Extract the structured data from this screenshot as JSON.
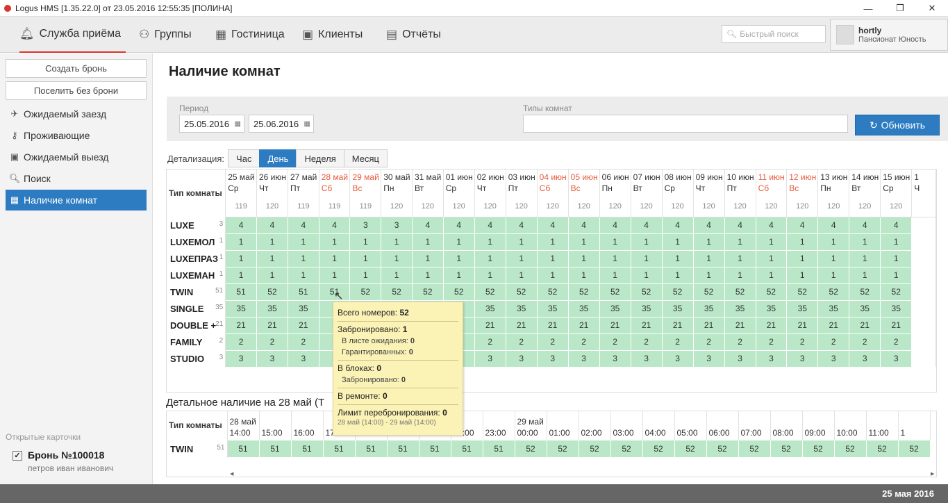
{
  "window": {
    "title": "Logus HMS [1.35.22.0] от 23.05.2016 12:55:35 [ПОЛИНА]"
  },
  "nav": {
    "items": [
      {
        "label": "Служба приёма"
      },
      {
        "label": "Группы"
      },
      {
        "label": "Гостиница"
      },
      {
        "label": "Клиенты"
      },
      {
        "label": "Отчёты"
      }
    ],
    "search_placeholder": "Быстрый поиск",
    "user": {
      "name": "hortly",
      "hotel": "Пансионат Юность"
    }
  },
  "sidebar": {
    "create": "Создать бронь",
    "checkin": "Поселить без брони",
    "menu": [
      {
        "label": "Ожидаемый заезд"
      },
      {
        "label": "Проживающие"
      },
      {
        "label": "Ожидаемый выезд"
      },
      {
        "label": "Поиск"
      },
      {
        "label": "Наличие комнат"
      }
    ],
    "open_cards_label": "Открытые карточки",
    "card": {
      "title": "Бронь №100018",
      "subtitle": "петров иван иванович"
    }
  },
  "page": {
    "title": "Наличие комнат",
    "period_label": "Период",
    "date_from": "25.05.2016",
    "date_to": "25.06.2016",
    "room_types_label": "Типы комнат",
    "refresh": "Обновить",
    "detail_label": "Детализация:",
    "detail_options": [
      "Час",
      "День",
      "Неделя",
      "Месяц"
    ],
    "detail_selected": "День",
    "grid_header": "Тип комнаты",
    "days": [
      [
        "25 май",
        "Ср",
        0
      ],
      [
        "26 июн",
        "Чт",
        0
      ],
      [
        "27 май",
        "Пт",
        0
      ],
      [
        "28 май",
        "Сб",
        1
      ],
      [
        "29 май",
        "Вс",
        1
      ],
      [
        "30 май",
        "Пн",
        0
      ],
      [
        "31 май",
        "Вт",
        0
      ],
      [
        "01 июн",
        "Ср",
        0
      ],
      [
        "02 июн",
        "Чт",
        0
      ],
      [
        "03 июн",
        "Пт",
        0
      ],
      [
        "04 июн",
        "Сб",
        1
      ],
      [
        "05 июн",
        "Вс",
        1
      ],
      [
        "06 июн",
        "Пн",
        0
      ],
      [
        "07 июн",
        "Вт",
        0
      ],
      [
        "08 июн",
        "Ср",
        0
      ],
      [
        "09 июн",
        "Чт",
        0
      ],
      [
        "10 июн",
        "Пт",
        0
      ],
      [
        "11 июн",
        "Сб",
        1
      ],
      [
        "12 июн",
        "Вс",
        1
      ],
      [
        "13 июн",
        "Пн",
        0
      ],
      [
        "14 июн",
        "Вт",
        0
      ],
      [
        "15 июн",
        "Ср",
        0
      ],
      [
        "1",
        "Ч",
        0
      ]
    ],
    "totals": [
      "119",
      "120",
      "119",
      "119",
      "119",
      "120",
      "120",
      "120",
      "120",
      "120",
      "120",
      "120",
      "120",
      "120",
      "120",
      "120",
      "120",
      "120",
      "120",
      "120",
      "120",
      "120",
      ""
    ],
    "rooms": [
      {
        "name": "LUXE",
        "qty": "3",
        "v": [
          "4",
          "4",
          "4",
          "4",
          "3",
          "3",
          "4",
          "4",
          "4",
          "4",
          "4",
          "4",
          "4",
          "4",
          "4",
          "4",
          "4",
          "4",
          "4",
          "4",
          "4",
          "4"
        ]
      },
      {
        "name": "LUXEМОЛ",
        "qty": "1",
        "v": [
          "1",
          "1",
          "1",
          "1",
          "1",
          "1",
          "1",
          "1",
          "1",
          "1",
          "1",
          "1",
          "1",
          "1",
          "1",
          "1",
          "1",
          "1",
          "1",
          "1",
          "1",
          "1"
        ]
      },
      {
        "name": "LUXEПРАЗ",
        "qty": "1",
        "v": [
          "1",
          "1",
          "1",
          "1",
          "1",
          "1",
          "1",
          "1",
          "1",
          "1",
          "1",
          "1",
          "1",
          "1",
          "1",
          "1",
          "1",
          "1",
          "1",
          "1",
          "1",
          "1"
        ]
      },
      {
        "name": "LUXEMAH",
        "qty": "1",
        "v": [
          "1",
          "1",
          "1",
          "1",
          "1",
          "1",
          "1",
          "1",
          "1",
          "1",
          "1",
          "1",
          "1",
          "1",
          "1",
          "1",
          "1",
          "1",
          "1",
          "1",
          "1",
          "1"
        ]
      },
      {
        "name": "TWIN",
        "qty": "51",
        "v": [
          "51",
          "52",
          "51",
          "51",
          "52",
          "52",
          "52",
          "52",
          "52",
          "52",
          "52",
          "52",
          "52",
          "52",
          "52",
          "52",
          "52",
          "52",
          "52",
          "52",
          "52",
          "52"
        ]
      },
      {
        "name": "SINGLE",
        "qty": "35",
        "v": [
          "35",
          "35",
          "35",
          "",
          "",
          "35",
          "35",
          "35",
          "35",
          "35",
          "35",
          "35",
          "35",
          "35",
          "35",
          "35",
          "35",
          "35",
          "35",
          "35",
          "35",
          "35"
        ]
      },
      {
        "name": "DOUBLE +",
        "qty": "21",
        "v": [
          "21",
          "21",
          "21",
          "",
          "",
          "21",
          "21",
          "21",
          "21",
          "21",
          "21",
          "21",
          "21",
          "21",
          "21",
          "21",
          "21",
          "21",
          "21",
          "21",
          "21",
          "21"
        ]
      },
      {
        "name": "FAMILY",
        "qty": "2",
        "v": [
          "2",
          "2",
          "2",
          "",
          "",
          "2",
          "2",
          "2",
          "2",
          "2",
          "2",
          "2",
          "2",
          "2",
          "2",
          "2",
          "2",
          "2",
          "2",
          "2",
          "2",
          "2"
        ]
      },
      {
        "name": "STUDIO",
        "qty": "3",
        "v": [
          "3",
          "3",
          "3",
          "",
          "",
          "3",
          "3",
          "3",
          "3",
          "3",
          "3",
          "3",
          "3",
          "3",
          "3",
          "3",
          "3",
          "3",
          "3",
          "3",
          "3",
          "3"
        ]
      }
    ],
    "detail_title": "Детальное наличие на 28 май (Т",
    "hours": [
      [
        "28 май",
        "14:00"
      ],
      [
        "",
        "15:00"
      ],
      [
        "",
        "16:00"
      ],
      [
        "",
        "17"
      ],
      [
        "",
        ""
      ],
      [
        "",
        ""
      ],
      [
        "",
        ""
      ],
      [
        "",
        "22:00"
      ],
      [
        "",
        "23:00"
      ],
      [
        "29 май",
        "00:00"
      ],
      [
        "",
        "01:00"
      ],
      [
        "",
        "02:00"
      ],
      [
        "",
        "03:00"
      ],
      [
        "",
        "04:00"
      ],
      [
        "",
        "05:00"
      ],
      [
        "",
        "06:00"
      ],
      [
        "",
        "07:00"
      ],
      [
        "",
        "08:00"
      ],
      [
        "",
        "09:00"
      ],
      [
        "",
        "10:00"
      ],
      [
        "",
        "11:00"
      ],
      [
        "",
        "1"
      ]
    ],
    "detail_room": {
      "name": "TWIN",
      "qty": "51",
      "v": [
        "51",
        "51",
        "51",
        "51",
        "51",
        "51",
        "51",
        "51",
        "51",
        "52",
        "52",
        "52",
        "52",
        "52",
        "52",
        "52",
        "52",
        "52",
        "52",
        "52",
        "52",
        "52"
      ]
    },
    "tooltip": {
      "total_label": "Всего номеров:",
      "total": "52",
      "booked_label": "Забронировано:",
      "booked": "1",
      "waitlist_label": "В листе ожидания:",
      "waitlist": "0",
      "guaranteed_label": "Гарантированных:",
      "guaranteed": "0",
      "blocks_label": "В блоках:",
      "blocks": "0",
      "blocks_booked_label": "Забронировано:",
      "blocks_booked": "0",
      "repair_label": "В ремонте:",
      "repair": "0",
      "overbook_label": "Лимит перебронирования:",
      "overbook": "0",
      "range": "28 май (14:00) - 29 май (14:00)"
    }
  },
  "footer": {
    "date": "25 мая 2016"
  }
}
